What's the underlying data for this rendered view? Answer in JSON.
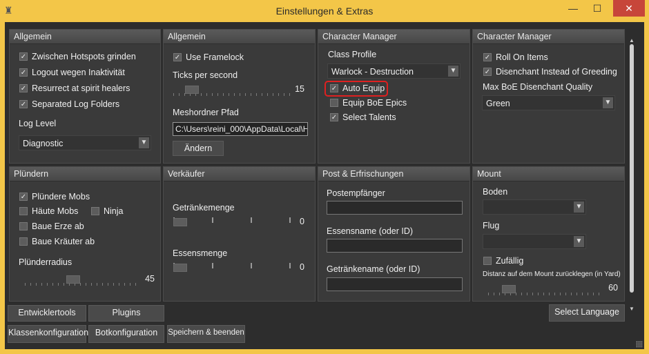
{
  "window": {
    "title": "Einstellungen & Extras",
    "min_label": "—",
    "max_label": "☐",
    "close_label": "✕"
  },
  "allgemein1": {
    "header": "Allgemein",
    "checks": [
      {
        "label": "Zwischen Hotspots grinden",
        "checked": true
      },
      {
        "label": "Logout wegen Inaktivität",
        "checked": true
      },
      {
        "label": "Resurrect at spirit healers",
        "checked": true
      },
      {
        "label": "Separated Log Folders",
        "checked": true
      }
    ],
    "log_level_label": "Log Level",
    "log_level_value": "Diagnostic"
  },
  "allgemein2": {
    "header": "Allgemein",
    "framelock": {
      "label": "Use Framelock",
      "checked": true
    },
    "ticks_label": "Ticks per second",
    "ticks_value": "15",
    "ticks_fraction": 0.1,
    "mesh_label": "Meshordner Pfad",
    "mesh_path": "C:\\Users\\reini_000\\AppData\\Local\\H",
    "change_button": "Ändern"
  },
  "charmgr1": {
    "header": "Character Manager",
    "class_profile_label": "Class Profile",
    "class_profile_value": "Warlock - Destruction",
    "checks": [
      {
        "label": "Auto Equip",
        "checked": true
      },
      {
        "label": "Equip BoE Epics",
        "checked": false
      },
      {
        "label": "Select Talents",
        "checked": true
      }
    ]
  },
  "charmgr2": {
    "header": "Character Manager",
    "checks": [
      {
        "label": "Roll On Items",
        "checked": true
      },
      {
        "label": "Disenchant Instead of Greeding",
        "checked": true
      }
    ],
    "quality_label": "Max BoE Disenchant Quality",
    "quality_value": "Green"
  },
  "pluendern": {
    "header": "Plündern",
    "checks": [
      {
        "label": "Plündere Mobs",
        "checked": true
      },
      {
        "label": "Häute Mobs",
        "checked": false
      },
      {
        "label": "Ninja",
        "checked": false
      },
      {
        "label": "Baue Erze ab",
        "checked": false
      },
      {
        "label": "Baue Kräuter ab",
        "checked": false
      }
    ],
    "radius_label": "Plünderradius",
    "radius_value": "45",
    "radius_fraction": 0.35
  },
  "verkaeufer": {
    "header": "Verkäufer",
    "drink_label": "Getränkemenge",
    "drink_value": "0",
    "food_label": "Essensmenge",
    "food_value": "0"
  },
  "post": {
    "header": "Post & Erfrischungen",
    "recipient_label": "Postempfänger",
    "food_label": "Essensname (oder ID)",
    "drink_label": "Getränkename (oder ID)"
  },
  "mount": {
    "header": "Mount",
    "ground_label": "Boden",
    "fly_label": "Flug",
    "random": {
      "label": "Zufällig",
      "checked": false
    },
    "distance_label": "Distanz auf dem Mount zurücklegen (in Yard)",
    "distance_value": "60",
    "distance_fraction": 0.15
  },
  "buttons": {
    "dev_tools": "Entwicklertools",
    "plugins": "Plugins",
    "class_config": "Klassenkonfiguration",
    "bot_config": "Botkonfiguration",
    "save_exit": "Speichern & beenden",
    "select_language": "Select Language"
  },
  "icons": {
    "check": "✓",
    "dropdown": "chevron-down-icon",
    "app": "rook-icon"
  }
}
